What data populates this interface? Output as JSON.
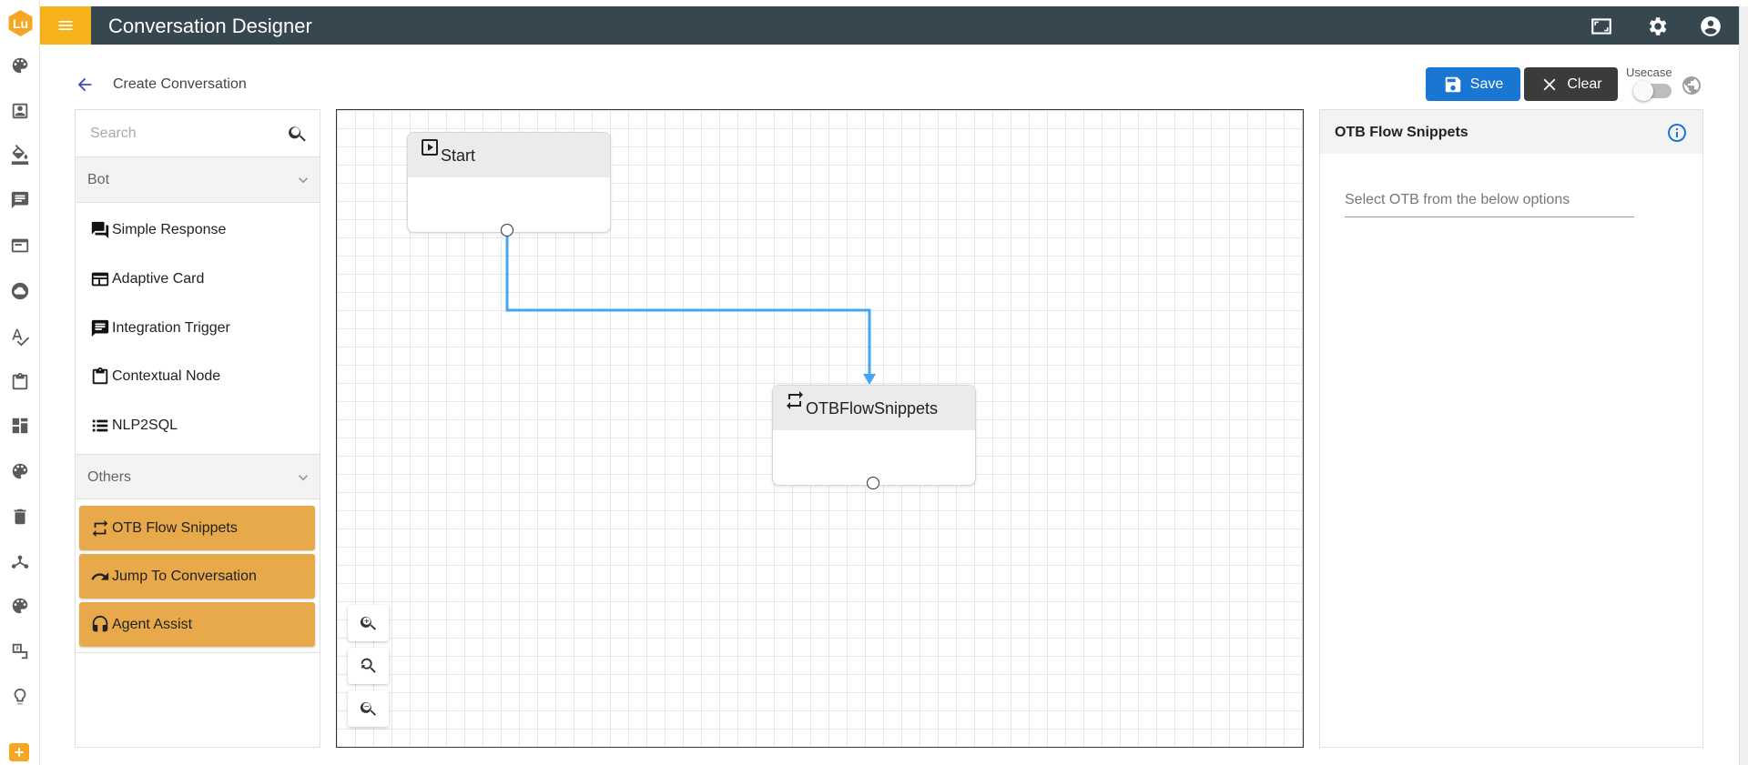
{
  "app": {
    "logo_text": "Lu",
    "title": "Conversation Designer"
  },
  "header": {
    "icons": [
      "fullscreen-icon",
      "settings-gear-icon",
      "account-circle-icon"
    ]
  },
  "rail": {
    "icons": [
      "palette-dots-icon",
      "contact-card-icon",
      "paint-bucket-icon",
      "chat-icon",
      "browser-window-icon",
      "cloud-circle-icon",
      "spellcheck-icon",
      "clipboard-icon",
      "dashboard-icon",
      "palette-dots-icon-2",
      "trash-icon",
      "hub-icon",
      "color-palette-icon",
      "translate-icon",
      "lightbulb-icon"
    ],
    "add_label": "+"
  },
  "toolbar": {
    "page_title": "Create Conversation",
    "save_label": "Save",
    "clear_label": "Clear",
    "usecase_label": "Usecase",
    "usecase_enabled": false
  },
  "palette": {
    "search_placeholder": "Search",
    "sections": [
      {
        "label": "Bot",
        "items": [
          "Simple Response",
          "Adaptive Card",
          "Integration Trigger",
          "Contextual Node",
          "NLP2SQL"
        ]
      },
      {
        "label": "Others",
        "items": [
          "OTB Flow Snippets",
          "Jump To Conversation",
          "Agent Assist"
        ]
      }
    ],
    "highlight_color": "#e8a94a"
  },
  "canvas": {
    "nodes": [
      {
        "title": "Start",
        "icon": "play-box-icon"
      },
      {
        "title": "OTBFlowSnippets",
        "icon": "repeat-icon"
      }
    ],
    "connector_color": "#42a5f5"
  },
  "properties": {
    "title": "OTB Flow Snippets",
    "select_placeholder": "Select OTB from the below options"
  },
  "colors": {
    "header_bg": "#37474f",
    "menu_accent": "#f5b21a",
    "save_button": "#1976d2",
    "clear_button": "#3b3b3b"
  }
}
